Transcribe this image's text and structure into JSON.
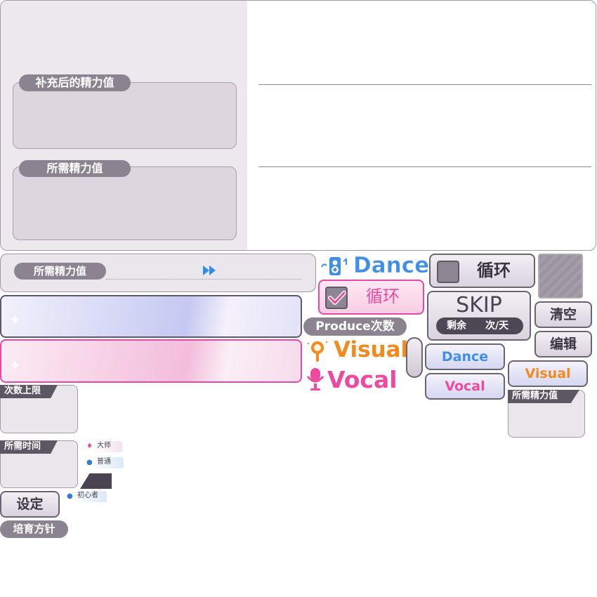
{
  "panel": {
    "label_after_refill": "补充后的精力值",
    "label_required": "所需精力值"
  },
  "produce_row": {
    "label": "所需精力值"
  },
  "stat_labels": {
    "dance": "Dance",
    "visual": "Visual",
    "vocal": "Vocal"
  },
  "loop": {
    "unchecked_label": "循环",
    "checked_label": "循环"
  },
  "skip": {
    "title": "SKIP",
    "remaining_label": "剩余",
    "per_day_label": "次/天"
  },
  "buttons": {
    "clear": "清空",
    "edit": "编辑",
    "set": "设定"
  },
  "produce_count_label": "Produce次数",
  "tabs": {
    "dance": "Dance",
    "vocal": "Vocal",
    "visual": "Visual"
  },
  "small_required": {
    "label": "所需精力值"
  },
  "sections": {
    "limit_label": "次数上限",
    "time_label": "所需时间",
    "policy_label": "培育方针"
  },
  "difficulty": {
    "master": "大师",
    "normal": "普通",
    "beginner": "初心者"
  },
  "colors": {
    "dance": "#3f8fe6",
    "visual": "#f28a1e",
    "vocal": "#ee4aa0",
    "frame": "#6b6372",
    "pill": "#8b8390"
  }
}
